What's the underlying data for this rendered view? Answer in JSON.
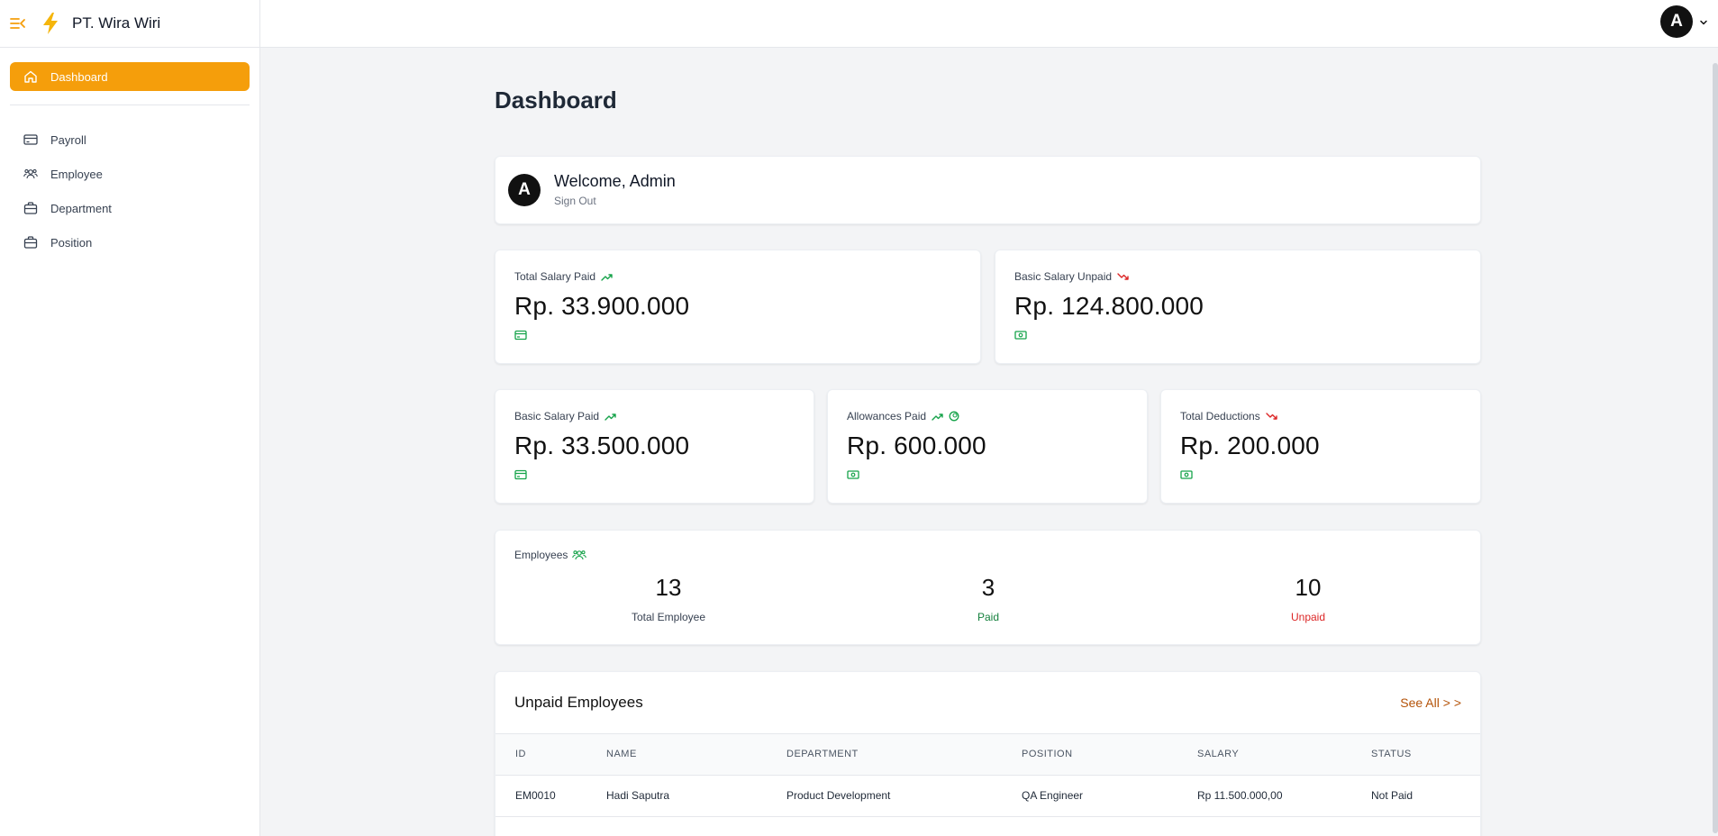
{
  "brand": {
    "name": "PT. Wira Wiri",
    "logo_icon": "lightning-icon",
    "toggle_icon": "menu-collapse-icon",
    "accent": "#f59e0b"
  },
  "sidebar": {
    "dashboard": {
      "label": "Dashboard",
      "icon": "home-icon"
    },
    "items": [
      {
        "label": "Payroll",
        "icon": "credit-card-icon"
      },
      {
        "label": "Employee",
        "icon": "users-icon"
      },
      {
        "label": "Department",
        "icon": "briefcase-icon"
      },
      {
        "label": "Position",
        "icon": "briefcase-icon"
      }
    ]
  },
  "header": {
    "avatar_letter": "A"
  },
  "page": {
    "title": "Dashboard"
  },
  "welcome": {
    "avatar_letter": "A",
    "title": "Welcome, Admin",
    "signout": "Sign Out"
  },
  "stats": {
    "total_salary_paid": {
      "label": "Total Salary Paid",
      "value": "Rp. 33.900.000"
    },
    "basic_salary_unpaid": {
      "label": "Basic Salary Unpaid",
      "value": "Rp. 124.800.000"
    },
    "basic_salary_paid": {
      "label": "Basic Salary Paid",
      "value": "Rp. 33.500.000"
    },
    "allowances_paid": {
      "label": "Allowances Paid",
      "value": "Rp. 600.000"
    },
    "total_deductions": {
      "label": "Total Deductions",
      "value": "Rp. 200.000"
    }
  },
  "employees": {
    "label": "Employees",
    "total": {
      "value": "13",
      "caption": "Total Employee"
    },
    "paid": {
      "value": "3",
      "caption": "Paid"
    },
    "unpaid": {
      "value": "10",
      "caption": "Unpaid"
    }
  },
  "unpaid_table": {
    "title": "Unpaid Employees",
    "see_all": "See All > >",
    "columns": [
      "ID",
      "NAME",
      "DEPARTMENT",
      "POSITION",
      "SALARY",
      "STATUS"
    ],
    "rows": [
      [
        "EM0010",
        "Hadi Saputra",
        "Product Development",
        "QA Engineer",
        "Rp 11.500.000,00",
        "Not Paid"
      ]
    ]
  },
  "colors": {
    "up": "#16a34a",
    "down": "#dc2626",
    "paid_text": "#15803d",
    "unpaid_text": "#dc2626"
  }
}
